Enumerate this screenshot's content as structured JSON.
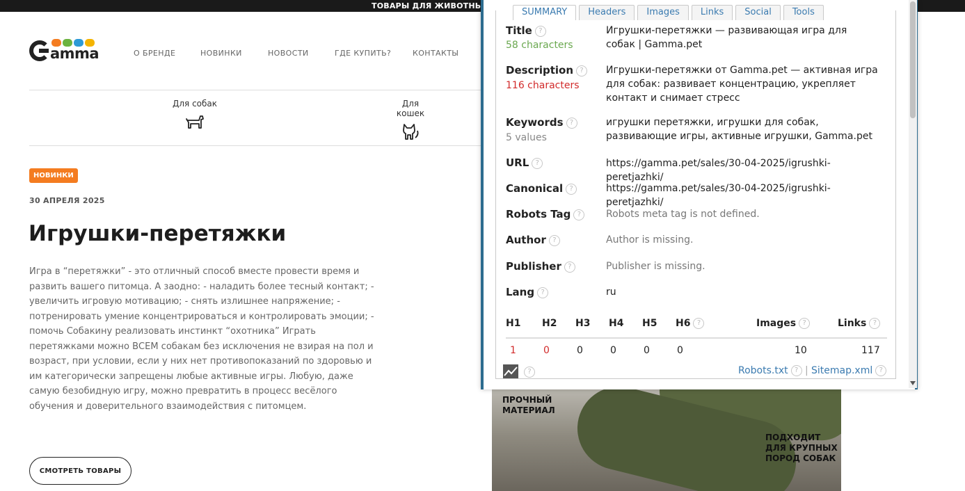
{
  "topbar": {
    "text": "ТОВАРЫ ДЛЯ ЖИВОТНЫХ"
  },
  "logo": {
    "text": "amma",
    "dot_colors": [
      "#f47c20",
      "#6cb33f",
      "#2d9ad6",
      "#f4b400"
    ]
  },
  "nav": {
    "items": [
      {
        "label": "О БРЕНДЕ"
      },
      {
        "label": "НОВИНКИ"
      },
      {
        "label": "НОВОСТИ"
      },
      {
        "label": "ГДЕ КУПИТЬ?"
      },
      {
        "label": "КОНТАКТЫ"
      }
    ]
  },
  "categories": [
    {
      "label": "Для собак",
      "icon": "dog-icon"
    },
    {
      "label": "Для кошек",
      "icon": "cat-icon"
    }
  ],
  "article": {
    "badge": "НОВИНКИ",
    "date": "30 АПРЕЛЯ 2025",
    "title": "Игрушки-перетяжки",
    "body": "Игра в “перетяжки” - это отличный способ вместе провести время и развить вашего питомца. А заодно: - наладить более тесный контакт; - увеличить игровую мотивацию; - снять излишнее напряжение; - потренировать умение концентрироваться и контролировать эмоции; - помочь Собакину реализовать инстинкт “охотника” Играть перетяжками можно ВСЕМ собакам без исключения не взирая на пол и возраст, при условии, если у них нет противопоказаний по здоровью и им категорически запрещены любые активные игры. Любую, даже самую безобидную игру, можно превратить в процесс весёлого обучения и доверительного взаимодействия с питомцем.",
    "button": "СМОТРЕТЬ ТОВАРЫ"
  },
  "promo": {
    "label1": "ПРОЧНЫЙ\nМАТЕРИАЛ",
    "label2": "ПОДХОДИТ\nДЛЯ КРУПНЫХ\nПОРОД СОБАК"
  },
  "seo": {
    "tabs": [
      "Summary",
      "Headers",
      "Images",
      "Links",
      "Social",
      "Tools"
    ],
    "rows": {
      "title": {
        "label": "Title",
        "sub": "58 characters",
        "value": "Игрушки-перетяжки — развивающая игра для собак | Gamma.pet"
      },
      "description": {
        "label": "Description",
        "sub": "116 characters",
        "value": "Игрушки-перетяжки от Gamma.pet — активная игра для собак: развивает концентрацию, укрепляет контакт и снимает стресс"
      },
      "keywords": {
        "label": "Keywords",
        "sub": "5 values",
        "value": "игрушки перетяжки, игрушки для собак, развивающие игры, активные игрушки, Gamma.pet"
      },
      "url": {
        "label": "URL",
        "value": "https://gamma.pet/sales/30-04-2025/igrushki-peretjazhki/"
      },
      "canonical": {
        "label": "Canonical",
        "value": "https://gamma.pet/sales/30-04-2025/igrushki-peretjazhki/"
      },
      "robots": {
        "label": "Robots Tag",
        "value": "Robots meta tag is not defined."
      },
      "author": {
        "label": "Author",
        "value": "Author is missing."
      },
      "publisher": {
        "label": "Publisher",
        "value": "Publisher is missing."
      },
      "lang": {
        "label": "Lang",
        "value": "ru"
      }
    },
    "headers_table": {
      "columns": [
        "H1",
        "H2",
        "H3",
        "H4",
        "H5",
        "H6",
        "Images",
        "Links"
      ],
      "values": [
        "1",
        "0",
        "0",
        "0",
        "0",
        "0",
        "10",
        "117"
      ]
    },
    "footer": {
      "robots": "Robots.txt",
      "sep": "|",
      "sitemap": "Sitemap.xml"
    },
    "colors": {
      "good": "#6aa84f",
      "bad": "#d22b2b",
      "link": "#3b7bb0",
      "frame": "#2d6c8f"
    }
  }
}
